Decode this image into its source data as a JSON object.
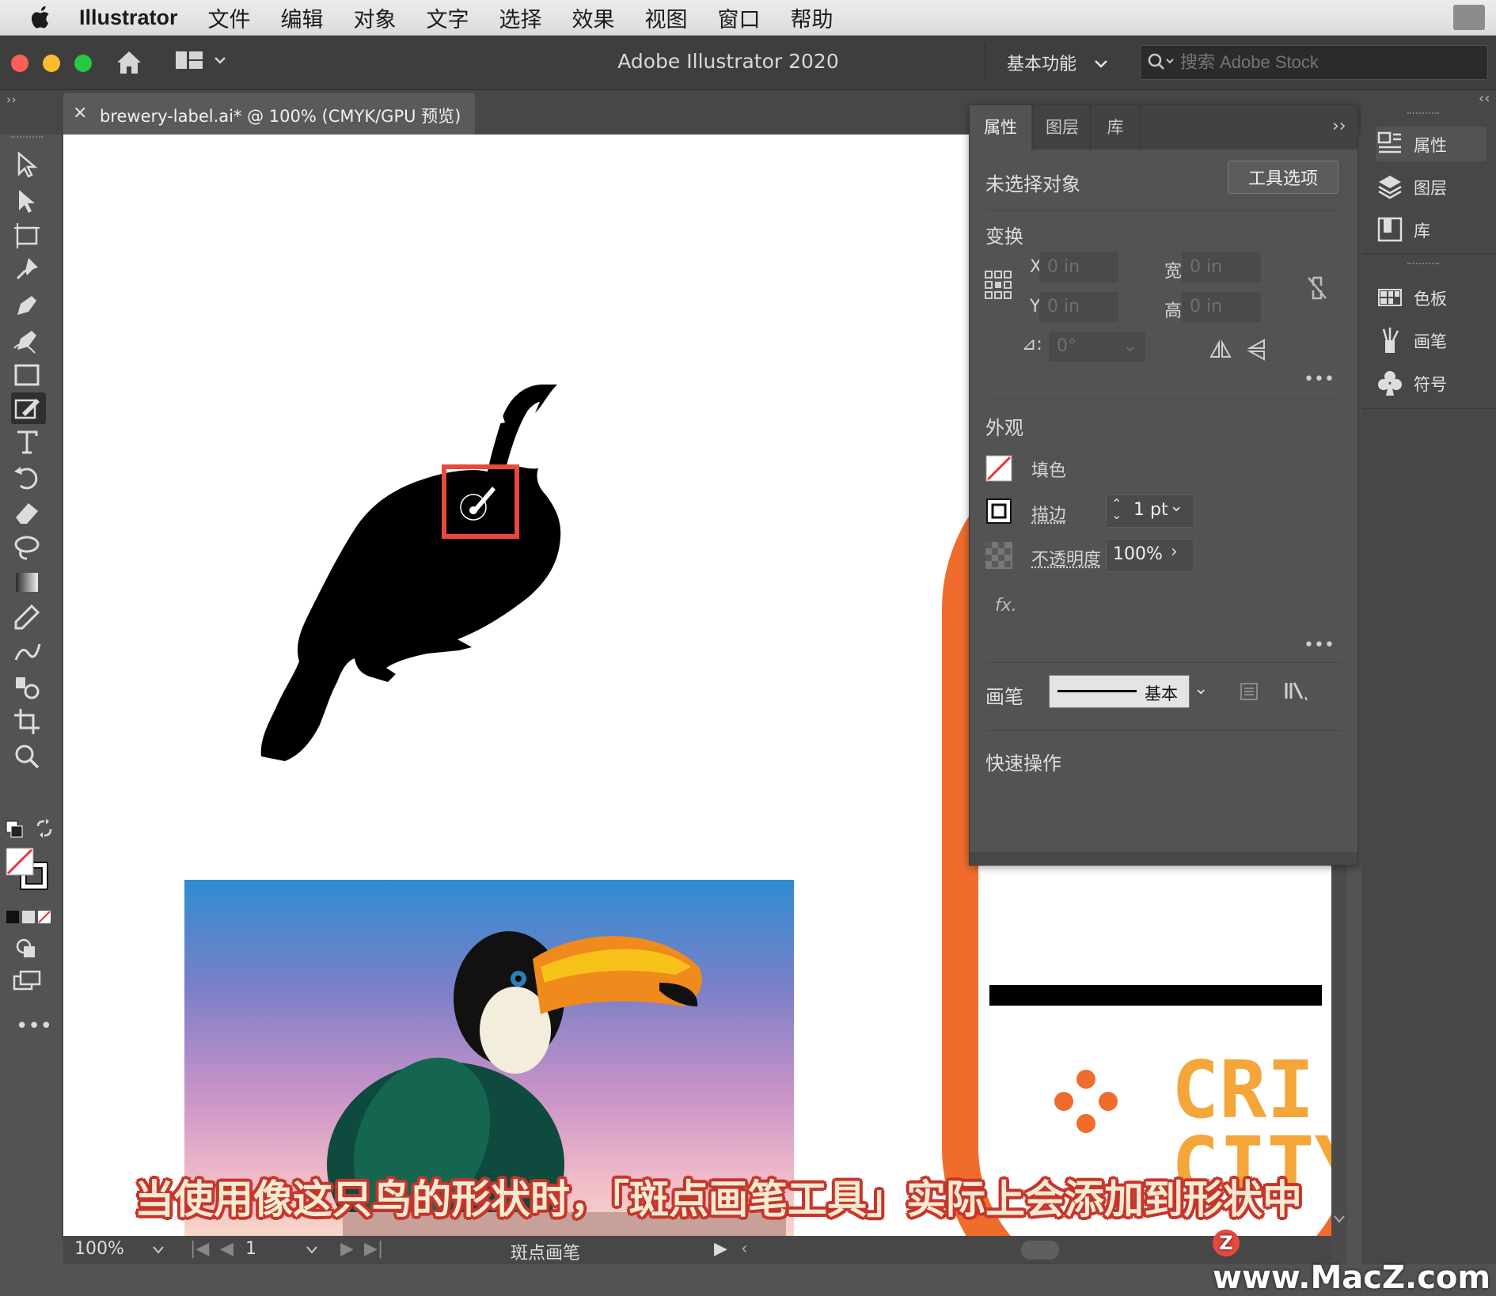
{
  "menubar": {
    "app_name": "Illustrator",
    "items": [
      "文件",
      "编辑",
      "对象",
      "文字",
      "选择",
      "效果",
      "视图",
      "窗口",
      "帮助"
    ]
  },
  "appbar": {
    "title": "Adobe Illustrator 2020",
    "workspace": "基本功能",
    "search_placeholder": "搜索 Adobe Stock"
  },
  "document": {
    "tab_title": "brewery-label.ai* @ 100% (CMYK/GPU 预览)",
    "close": "×"
  },
  "properties": {
    "tabs": [
      "属性",
      "图层",
      "库"
    ],
    "active_tab": "属性",
    "no_selection": "未选择对象",
    "tool_options_button": "工具选项",
    "transform": {
      "title": "变换",
      "x_label": "X:",
      "x_value": "0 in",
      "y_label": "Y:",
      "y_value": "0 in",
      "w_label": "宽:",
      "w_value": "0 in",
      "h_label": "高:",
      "h_value": "0 in",
      "angle_label": "⊿:",
      "angle_value": "0°"
    },
    "appearance": {
      "title": "外观",
      "fill_label": "填色",
      "stroke_label": "描边",
      "stroke_value": "1 pt",
      "opacity_label": "不透明度",
      "opacity_value": "100%",
      "fx_label": "fx."
    },
    "brush": {
      "title": "画笔",
      "value": "基本"
    },
    "quick_actions": "快速操作"
  },
  "dock": {
    "items": [
      "属性",
      "图层",
      "库",
      "色板",
      "画笔",
      "符号"
    ]
  },
  "status": {
    "zoom": "100%",
    "artboard": "1",
    "tool_name": "斑点画笔"
  },
  "canvas": {
    "logo_text_line1": "CRI",
    "logo_text_line2": "CITY",
    "accent_orange": "#ef6c2d",
    "logo_yellow": "#f4a63a",
    "highlight_red": "#e8493c"
  },
  "caption": "当使用像这只鸟的形状时，「斑点画笔工具」实际上会添加到形状中",
  "watermark": "www.MacZ.com"
}
